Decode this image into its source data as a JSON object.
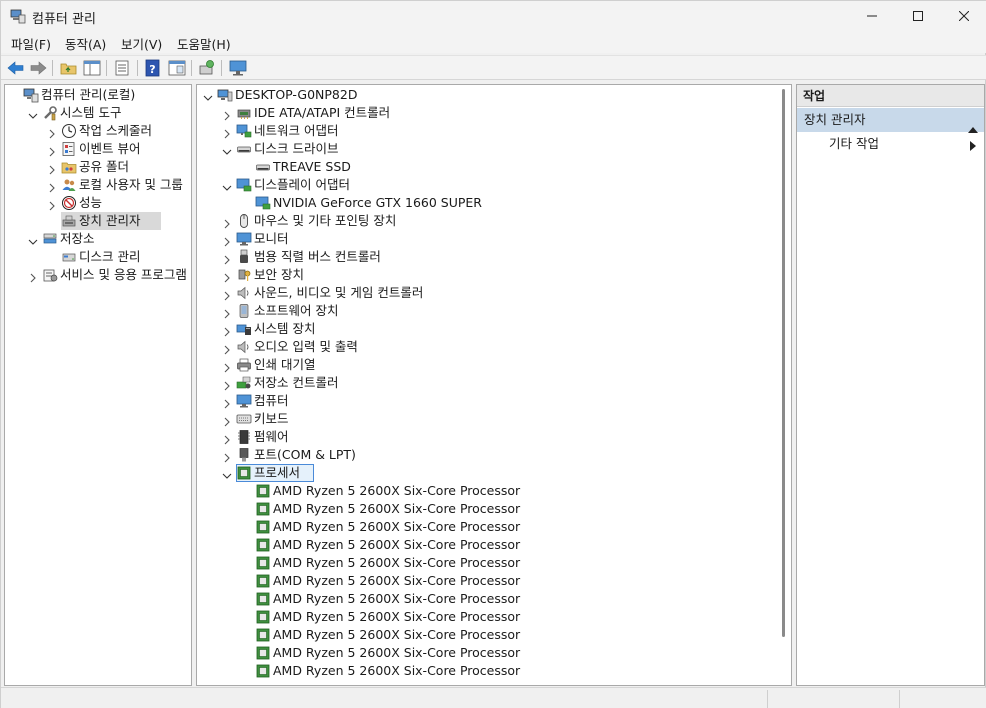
{
  "window": {
    "title": "컴퓨터 관리",
    "accent": "#c8d9ea"
  },
  "menu": [
    "파일(F)",
    "동작(A)",
    "보기(V)",
    "도움말(H)"
  ],
  "left_tree": [
    {
      "label": "컴퓨터 관리(로컬)",
      "icon": "computer-management-icon",
      "level": 0,
      "expander": "none"
    },
    {
      "label": "시스템 도구",
      "icon": "tools-icon",
      "level": 1,
      "expander": "expanded"
    },
    {
      "label": "작업 스케줄러",
      "icon": "clock-icon",
      "level": 2,
      "expander": "collapsed"
    },
    {
      "label": "이벤트 뷰어",
      "icon": "event-viewer-icon",
      "level": 2,
      "expander": "collapsed"
    },
    {
      "label": "공유 폴더",
      "icon": "shared-folder-icon",
      "level": 2,
      "expander": "collapsed"
    },
    {
      "label": "로컬 사용자 및 그룹",
      "icon": "users-icon",
      "level": 2,
      "expander": "collapsed"
    },
    {
      "label": "성능",
      "icon": "performance-icon",
      "level": 2,
      "expander": "collapsed"
    },
    {
      "label": "장치 관리자",
      "icon": "device-manager-icon",
      "level": 2,
      "expander": "none",
      "selected": true
    },
    {
      "label": "저장소",
      "icon": "storage-icon",
      "level": 1,
      "expander": "expanded"
    },
    {
      "label": "디스크 관리",
      "icon": "disk-icon",
      "level": 2,
      "expander": "none"
    },
    {
      "label": "서비스 및 응용 프로그램",
      "icon": "services-icon",
      "level": 1,
      "expander": "collapsed"
    }
  ],
  "device_tree": [
    {
      "label": "DESKTOP-G0NP82D",
      "icon": "computer-icon",
      "level": 0,
      "expander": "expanded"
    },
    {
      "label": "IDE ATA/ATAPI 컨트롤러",
      "icon": "ide-controller-icon",
      "level": 1,
      "expander": "collapsed"
    },
    {
      "label": "네트워크 어댑터",
      "icon": "network-adapter-icon",
      "level": 1,
      "expander": "collapsed"
    },
    {
      "label": "디스크 드라이브",
      "icon": "disk-drive-icon",
      "level": 1,
      "expander": "expanded"
    },
    {
      "label": "TREAVE SSD",
      "icon": "disk-drive-icon",
      "level": 2,
      "expander": "none"
    },
    {
      "label": "디스플레이 어댑터",
      "icon": "display-adapter-icon",
      "level": 1,
      "expander": "expanded"
    },
    {
      "label": "NVIDIA GeForce GTX 1660 SUPER",
      "icon": "display-adapter-icon",
      "level": 2,
      "expander": "none"
    },
    {
      "label": "마우스 및 기타 포인팅 장치",
      "icon": "mouse-icon",
      "level": 1,
      "expander": "collapsed"
    },
    {
      "label": "모니터",
      "icon": "monitor-icon",
      "level": 1,
      "expander": "collapsed"
    },
    {
      "label": "범용 직렬 버스 컨트롤러",
      "icon": "usb-icon",
      "level": 1,
      "expander": "collapsed"
    },
    {
      "label": "보안 장치",
      "icon": "security-device-icon",
      "level": 1,
      "expander": "collapsed"
    },
    {
      "label": "사운드, 비디오 및 게임 컨트롤러",
      "icon": "speaker-icon",
      "level": 1,
      "expander": "collapsed"
    },
    {
      "label": "소프트웨어 장치",
      "icon": "software-device-icon",
      "level": 1,
      "expander": "collapsed"
    },
    {
      "label": "시스템 장치",
      "icon": "system-device-icon",
      "level": 1,
      "expander": "collapsed"
    },
    {
      "label": "오디오 입력 및 출력",
      "icon": "speaker-icon",
      "level": 1,
      "expander": "collapsed"
    },
    {
      "label": "인쇄 대기열",
      "icon": "printer-icon",
      "level": 1,
      "expander": "collapsed"
    },
    {
      "label": "저장소 컨트롤러",
      "icon": "storage-controller-icon",
      "level": 1,
      "expander": "collapsed"
    },
    {
      "label": "컴퓨터",
      "icon": "monitor-icon",
      "level": 1,
      "expander": "collapsed"
    },
    {
      "label": "키보드",
      "icon": "keyboard-icon",
      "level": 1,
      "expander": "collapsed"
    },
    {
      "label": "펌웨어",
      "icon": "firmware-icon",
      "level": 1,
      "expander": "collapsed"
    },
    {
      "label": "포트(COM & LPT)",
      "icon": "port-icon",
      "level": 1,
      "expander": "collapsed"
    },
    {
      "label": "프로세서",
      "icon": "processor-icon",
      "level": 1,
      "expander": "expanded",
      "focused": true
    },
    {
      "label": "AMD Ryzen 5 2600X Six-Core Processor",
      "icon": "processor-icon",
      "level": 2,
      "expander": "none"
    },
    {
      "label": "AMD Ryzen 5 2600X Six-Core Processor",
      "icon": "processor-icon",
      "level": 2,
      "expander": "none"
    },
    {
      "label": "AMD Ryzen 5 2600X Six-Core Processor",
      "icon": "processor-icon",
      "level": 2,
      "expander": "none"
    },
    {
      "label": "AMD Ryzen 5 2600X Six-Core Processor",
      "icon": "processor-icon",
      "level": 2,
      "expander": "none"
    },
    {
      "label": "AMD Ryzen 5 2600X Six-Core Processor",
      "icon": "processor-icon",
      "level": 2,
      "expander": "none"
    },
    {
      "label": "AMD Ryzen 5 2600X Six-Core Processor",
      "icon": "processor-icon",
      "level": 2,
      "expander": "none"
    },
    {
      "label": "AMD Ryzen 5 2600X Six-Core Processor",
      "icon": "processor-icon",
      "level": 2,
      "expander": "none"
    },
    {
      "label": "AMD Ryzen 5 2600X Six-Core Processor",
      "icon": "processor-icon",
      "level": 2,
      "expander": "none"
    },
    {
      "label": "AMD Ryzen 5 2600X Six-Core Processor",
      "icon": "processor-icon",
      "level": 2,
      "expander": "none"
    },
    {
      "label": "AMD Ryzen 5 2600X Six-Core Processor",
      "icon": "processor-icon",
      "level": 2,
      "expander": "none"
    },
    {
      "label": "AMD Ryzen 5 2600X Six-Core Processor",
      "icon": "processor-icon",
      "level": 2,
      "expander": "none"
    }
  ],
  "actions": {
    "header": "작업",
    "group": "장치 관리자",
    "item": "기타 작업"
  }
}
